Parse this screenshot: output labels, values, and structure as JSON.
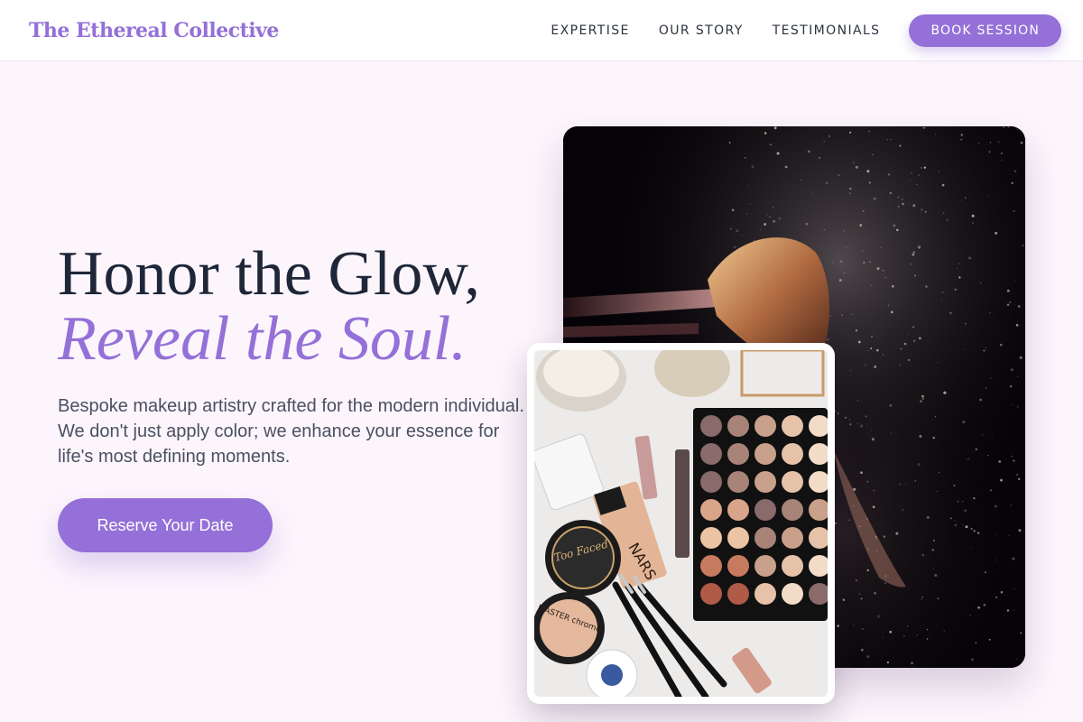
{
  "header": {
    "logo": "The Ethereal Collective",
    "nav": [
      "EXPERTISE",
      "OUR STORY",
      "TESTIMONIALS"
    ],
    "cta": "BOOK SESSION"
  },
  "hero": {
    "title_line1": "Honor the Glow,",
    "title_line2": "Reveal the Soul.",
    "description": "Bespoke makeup artistry crafted for the modern individual. We don't just apply color; we enhance your essence for life's most defining moments.",
    "cta": "Reserve Your Date"
  },
  "images": {
    "main_alt": "Makeup brush with powder dust",
    "overlay_alt": "Flat lay of makeup products",
    "overlay_label_too_faced": "Too Faced",
    "overlay_label_nars": "NARS",
    "overlay_label_master": "MASTER chrome"
  },
  "colors": {
    "accent": "#9470d8",
    "background": "#fcf5fc",
    "heading": "#1e2638",
    "body_text": "#4a5060"
  }
}
